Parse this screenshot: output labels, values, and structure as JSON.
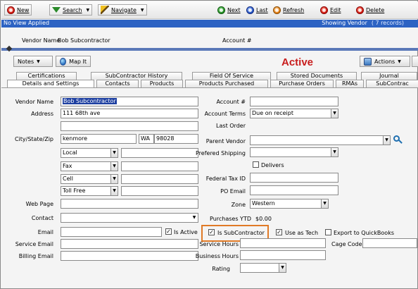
{
  "toolbar": {
    "new_label": "New",
    "search_label": "Search",
    "navigate_label": "Navigate",
    "next_label": "Next",
    "last_label": "Last",
    "refresh_label": "Refresh",
    "edit_label": "Edit",
    "delete_label": "Delete"
  },
  "view_bar": {
    "left_text": "No View Applied",
    "showing_text": "Showing  Vendor",
    "count_text": "( 7 records)"
  },
  "summary": {
    "vendor_name_label": "Vendor Name",
    "vendor_name_value": "Bob Subcontractor",
    "account_label": "Account #"
  },
  "actions": {
    "notes_label": "Notes",
    "map_label": "Map It",
    "status_text": "Active",
    "actions_label": "Actions"
  },
  "tabs_row1": [
    "Certifications",
    "SubContractor History",
    "Field Of Service",
    "Stored Documents",
    "Journal"
  ],
  "tabs_row2": [
    "Details and Settings",
    "Contacts",
    "Products",
    "Products Purchased",
    "Purchase Orders",
    "RMAs",
    "SubContrac"
  ],
  "form": {
    "vendor_name_label": "Vendor Name",
    "vendor_name_value": "Bob Subcontractor",
    "address_label": "Address",
    "address1_value": "111 68th ave",
    "address2_value": "",
    "city_label": "City/State/Zip",
    "city_value": "kenmore",
    "state_value": "WA",
    "zip_value": "98028",
    "phone1_type": "Local",
    "phone2_type": "Fax",
    "phone3_type": "Cell",
    "phone4_type": "Toll Free",
    "web_page_label": "Web Page",
    "contact_label": "Contact",
    "email_label": "Email",
    "is_active_label": "Is Active",
    "service_email_label": "Service Email",
    "billing_email_label": "Billing Email",
    "account_label": "Account #",
    "account_terms_label": "Account Terms",
    "account_terms_value": "Due on receipt",
    "last_order_label": "Last Order",
    "parent_vendor_label": "Parent Vendor",
    "preferred_shipping_label": "Prefered Shipping",
    "delivers_label": "Delivers",
    "federal_tax_label": "Federal Tax ID",
    "po_email_label": "PO Email",
    "zone_label": "Zone",
    "zone_value": "Western",
    "purchases_ytd_label": "Purchases YTD",
    "purchases_ytd_value": "$0.00",
    "is_subcontractor_label": "Is SubContractor",
    "use_as_tech_label": "Use as Tech",
    "export_qb_label": "Export to QuickBooks",
    "service_hours_label": "Service Hours",
    "cage_code_label": "Cage Code",
    "business_hours_label": "Business Hours",
    "rating_label": "Rating"
  },
  "checks": {
    "is_active": true,
    "is_subcontractor": true,
    "use_as_tech": true,
    "export_qb": false,
    "delivers": false
  },
  "check_mark": "✓",
  "icons": {
    "new": "new-icon",
    "search": "search-funnel-icon",
    "navigate": "navigate-wand-icon",
    "next": "next-icon",
    "last": "last-icon",
    "refresh": "refresh-icon",
    "edit": "edit-icon",
    "delete": "delete-icon",
    "map": "globe-icon",
    "actions": "actions-icon",
    "lookup": "magnifier-icon"
  },
  "colors": {
    "view_bar": "#2d63c3",
    "status": "#c81d1d",
    "highlight": "#e07a26"
  }
}
